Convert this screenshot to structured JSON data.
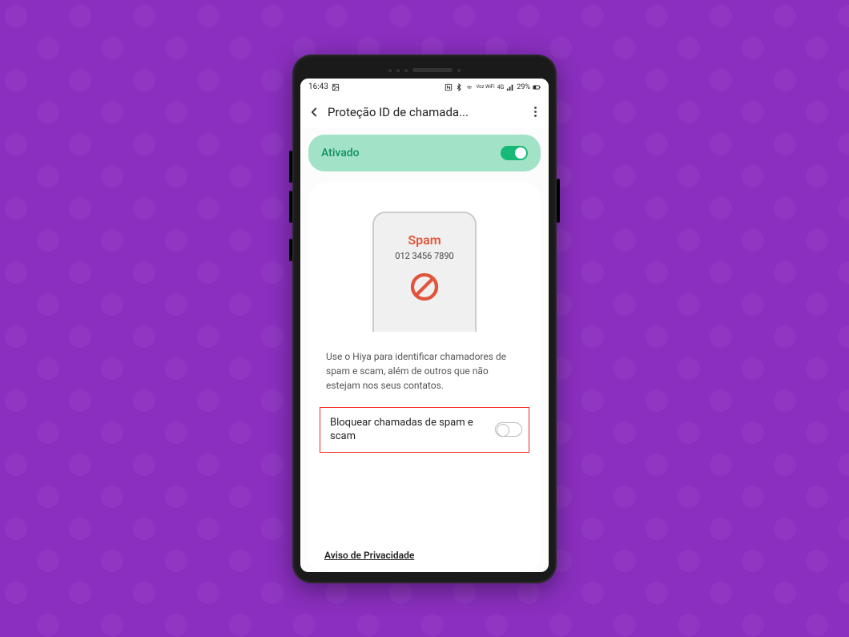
{
  "statusBar": {
    "time": "16:43",
    "network_label": "Voz WiFi",
    "signal_label": "4G",
    "battery_percent": "29%"
  },
  "header": {
    "title": "Proteção ID de chamada..."
  },
  "activated": {
    "label": "Ativado"
  },
  "illustration": {
    "spam_label": "Spam",
    "spam_number": "012 3456 7890"
  },
  "description": "Use o Hiya para identificar chamadores de spam e scam, além de outros que não estejam nos seus contatos.",
  "option": {
    "label": "Bloquear chamadas de spam e scam"
  },
  "privacy_link": "Aviso de Privacidade"
}
